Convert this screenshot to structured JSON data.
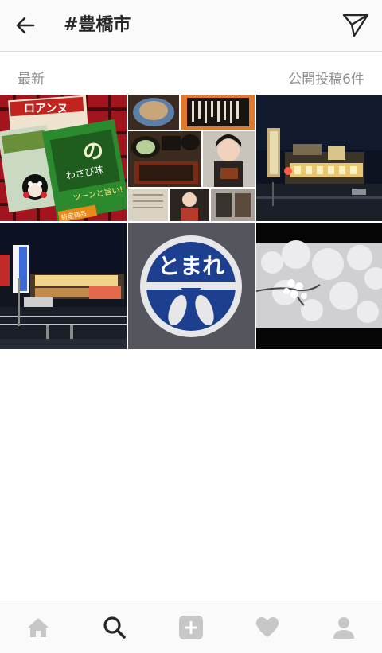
{
  "header": {
    "back_icon": "arrow-left-icon",
    "title": "#豊橋市",
    "send_icon": "paper-plane-icon"
  },
  "subbar": {
    "sort_label": "最新",
    "post_count": "公開投稿6件"
  },
  "posts": [
    {
      "subject": "snack packages on red plaid cloth",
      "text_marks": [
        "ロアンヌ",
        "わさび味",
        "ツーンと旨い!",
        "特定商品"
      ]
    },
    {
      "subject": "restaurant collage with unagi and woman",
      "text_marks": []
    },
    {
      "subject": "lit building at night",
      "text_marks": []
    },
    {
      "subject": "roadside shop at night",
      "text_marks": []
    },
    {
      "subject": "road marking stop sign",
      "text_marks": [
        "とまれ"
      ]
    },
    {
      "subject": "cherry blossoms",
      "text_marks": []
    }
  ],
  "tabbar": {
    "tabs": [
      {
        "icon": "home-icon",
        "active": false
      },
      {
        "icon": "search-icon",
        "active": true
      },
      {
        "icon": "add-post-icon",
        "active": false
      },
      {
        "icon": "heart-icon",
        "active": false
      },
      {
        "icon": "profile-icon",
        "active": false
      }
    ]
  },
  "colors": {
    "active_icon": "#262626",
    "inactive_icon": "#c7c7c7",
    "secondary_text": "#8e8e8e",
    "stop_sign_blue": "#1c3f8f"
  }
}
